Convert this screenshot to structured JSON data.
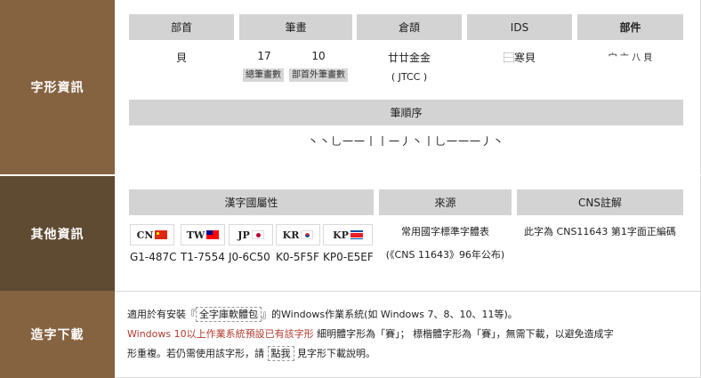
{
  "glyph_info": {
    "side_label": "字形資訊",
    "radical": {
      "header": "部首",
      "value": "貝"
    },
    "strokes": {
      "header": "筆畫",
      "total": "17",
      "extra": "10",
      "total_label": "總筆畫數",
      "extra_label": "部首外筆畫數"
    },
    "cangjie": {
      "header": "倉頡",
      "value": "廿廿金金",
      "code": "( JTCC )"
    },
    "ids": {
      "header": "IDS",
      "value": "⿱寒貝"
    },
    "components": {
      "header": "部件",
      "value": "宀 亠 八 貝"
    },
    "stroke_order": {
      "header": "筆順序",
      "value": "丶丶乚一一丨丨一丿丶丨乚一一一丿丶"
    }
  },
  "other_info": {
    "side_label": "其他資訊",
    "attribution_header": "漢字國屬性",
    "flags": [
      {
        "label": "CN",
        "code": "G1-487C"
      },
      {
        "label": "TW",
        "code": "T1-7554"
      },
      {
        "label": "JP",
        "code": "J0-6C50"
      },
      {
        "label": "KR",
        "code": "K0-5F5F"
      },
      {
        "label": "KP",
        "code": "KP0-E5EF"
      }
    ],
    "source": {
      "header": "來源",
      "line1": "常用國字標準字體表",
      "line2": "(《CNS 11643》96年公布)"
    },
    "cns": {
      "header": "CNS註解",
      "value": "此字為 CNS11643 第1字面正編碼"
    }
  },
  "download": {
    "side_label": "造字下載",
    "line1_pre": "適用於有安裝『",
    "line1_link": "全字庫軟體包",
    "line1_post": "』的Windows作業系統(如 Windows 7、8、10、11等)。",
    "line2_red": "Windows 10以上作業系統預設已有該字形",
    "line2_post": " 細明體字形為「賽」； 標楷體字形為「賽」，無需下載，以避免造成字",
    "line3_pre": "形重複。若仍需使用該字形，請 ",
    "line3_link": "點我",
    "line3_post": " 見字形下載說明。"
  }
}
